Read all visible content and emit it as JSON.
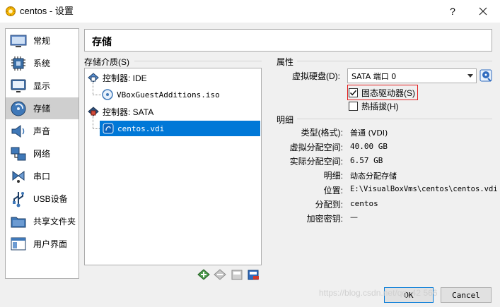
{
  "window": {
    "title": "centos - 设置",
    "help_label": "?",
    "icon": "virtualbox-icon"
  },
  "nav": {
    "items": [
      {
        "label": "常规",
        "icon": "general-icon"
      },
      {
        "label": "系统",
        "icon": "system-chip-icon"
      },
      {
        "label": "显示",
        "icon": "display-monitor-icon"
      },
      {
        "label": "存储",
        "icon": "storage-disk-icon",
        "selected": true
      },
      {
        "label": "声音",
        "icon": "speaker-icon"
      },
      {
        "label": "网络",
        "icon": "network-icon"
      },
      {
        "label": "串口",
        "icon": "serial-port-icon"
      },
      {
        "label": "USB设备",
        "icon": "usb-icon"
      },
      {
        "label": "共享文件夹",
        "icon": "shared-folder-icon"
      },
      {
        "label": "用户界面",
        "icon": "user-interface-icon"
      }
    ]
  },
  "page": {
    "title": "存储"
  },
  "storage_tree": {
    "group_label": "存储介质(S)",
    "rows": [
      {
        "label": "控制器: IDE",
        "icon": "ide-controller-icon",
        "level": 0
      },
      {
        "label": "VBoxGuestAdditions.iso",
        "icon": "optical-disc-icon",
        "level": 1
      },
      {
        "label": "控制器: SATA",
        "icon": "sata-controller-icon",
        "level": 0
      },
      {
        "label": "centos.vdi",
        "icon": "hard-disk-icon",
        "level": 1,
        "selected": true
      }
    ],
    "toolbar": [
      "add-controller-icon",
      "remove-controller-icon",
      "add-attachment-icon",
      "remove-attachment-icon"
    ]
  },
  "attributes": {
    "group_label": "属性",
    "hard_disk_label": "虚拟硬盘(D):",
    "hard_disk_value": "SATA 端口 0",
    "ssd_label": "固态驱动器(S)",
    "ssd_checked": true,
    "hotplug_label": "热插拔(H)",
    "hotplug_checked": false
  },
  "details": {
    "group_label": "明细",
    "rows": [
      {
        "key": "类型(格式):",
        "value": "普通 (VDI)"
      },
      {
        "key": "虚拟分配空间:",
        "value": "40.00 GB"
      },
      {
        "key": "实际分配空间:",
        "value": "6.57 GB"
      },
      {
        "key": "明细:",
        "value": "动态分配存储"
      },
      {
        "key": "位置:",
        "value": "E:\\VisualBoxVms\\centos\\centos.vdi"
      },
      {
        "key": "分配到:",
        "value": "centos"
      },
      {
        "key": "加密密钥:",
        "value": "—"
      }
    ]
  },
  "buttons": {
    "ok": "OK",
    "cancel": "Cancel"
  },
  "watermark": "https://blog.csdn.net/qq_42 566",
  "colors": {
    "selection": "#0078d7",
    "highlight_box": "#e21f1f"
  }
}
